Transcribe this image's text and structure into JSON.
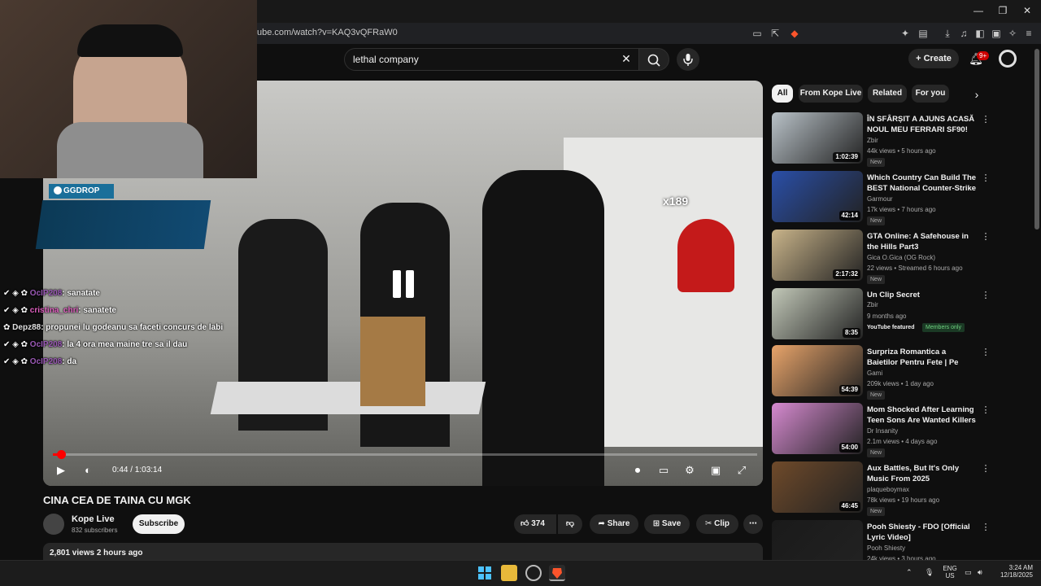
{
  "browser": {
    "url": "ube.com/watch?v=KAQ3vQFRaW0",
    "window_controls": {
      "minimize": "—",
      "restore": "❐",
      "close": "✕"
    }
  },
  "youtube_header": {
    "search_value": "lethal company",
    "create_label": "Create",
    "notification_count": "9+"
  },
  "webcam_overlay": {
    "ggdrop_label": "GGDROP"
  },
  "chat": [
    {
      "user": "OcIP208",
      "message": "sanatate"
    },
    {
      "user": "cristina_chri",
      "message": "sanatete"
    },
    {
      "user": "Depz88",
      "message": "propunei lu godeanu sa faceti concurs de labi"
    },
    {
      "user": "OcIP208",
      "message": "la 4 ora mea maine tre sa il dau"
    },
    {
      "user": "OcIP208",
      "message": "da"
    }
  ],
  "player": {
    "time": "0:44 / 1:03:14",
    "progress_fraction": 0.012,
    "in_video_counter": "x189"
  },
  "video": {
    "title": "CINA CEA DE TAINA CU MGK",
    "channel_name": "Kope Live",
    "channel_subs": "832 subscribers",
    "subscribe_label": "Subscribe",
    "like_count": "374",
    "share_label": "Share",
    "save_label": "Save",
    "clip_label": "Clip",
    "description_meta": "2,801 views  2 hours ago"
  },
  "chips": [
    {
      "label": "All",
      "active": true
    },
    {
      "label": "From Kope Live",
      "active": false
    },
    {
      "label": "Related",
      "active": false
    },
    {
      "label": "For you",
      "active": false
    }
  ],
  "recommendations": [
    {
      "title": "ÎN SFÂRȘIT A AJUNS ACASĂ NOUL MEU FERRARI SF90!",
      "channel": "Zbir",
      "meta": "44k views • 5 hours ago",
      "duration": "1:02:39",
      "badge": "New",
      "thumb_color": "#b9c2c8"
    },
    {
      "title": "Which Country Can Build The BEST National Counter-Strike ...",
      "channel": "Garmour",
      "meta": "17k views • 7 hours ago",
      "duration": "42:14",
      "badge": "New",
      "thumb_color": "#2a4fa8"
    },
    {
      "title": "GTA Online: A Safehouse in the Hills Part3",
      "channel": "Gica O.Gica (OG Rock)",
      "meta": "22 views • Streamed 6 hours ago",
      "duration": "2:17:32",
      "badge": "New",
      "thumb_color": "#c9b48a"
    },
    {
      "title": "Un Clip Secret",
      "channel": "Zbir",
      "meta": "9 months ago",
      "duration": "8:35",
      "badge": "YouTube featured",
      "members": "Members only",
      "thumb_color": "#c2c8b8"
    },
    {
      "title": "Surpriza Romantica a Baietilor Pentru Fete | Pe Combinatii Ep...",
      "channel": "Gami",
      "meta": "209k views • 1 day ago",
      "duration": "54:39",
      "badge": "New",
      "thumb_color": "#e8a46a"
    },
    {
      "title": "Mom Shocked After Learning Teen Sons Are Wanted Killers",
      "channel": "Dr Insanity",
      "meta": "2.1m views • 4 days ago",
      "duration": "54:00",
      "badge": "New",
      "thumb_color": "#d68ad0"
    },
    {
      "title": "Aux Battles, But It's Only Music From 2025",
      "channel": "plaqueboymax",
      "meta": "78k views • 19 hours ago",
      "duration": "46:45",
      "badge": "New",
      "thumb_color": "#6f4a2a"
    },
    {
      "title": "Pooh Shiesty - FDO [Official Lyric Video]",
      "channel": "Pooh Shiesty",
      "meta": "24k views • 3 hours ago",
      "duration": "",
      "badge": "",
      "thumb_color": "#1a1a1a"
    }
  ],
  "taskbar": {
    "lang": "ENG",
    "region": "US",
    "time": "3:24 AM",
    "date": "12/18/2025"
  },
  "colors": {
    "accent_red": "#ff0000",
    "bg": "#0f0f0f",
    "surface": "#272727"
  }
}
